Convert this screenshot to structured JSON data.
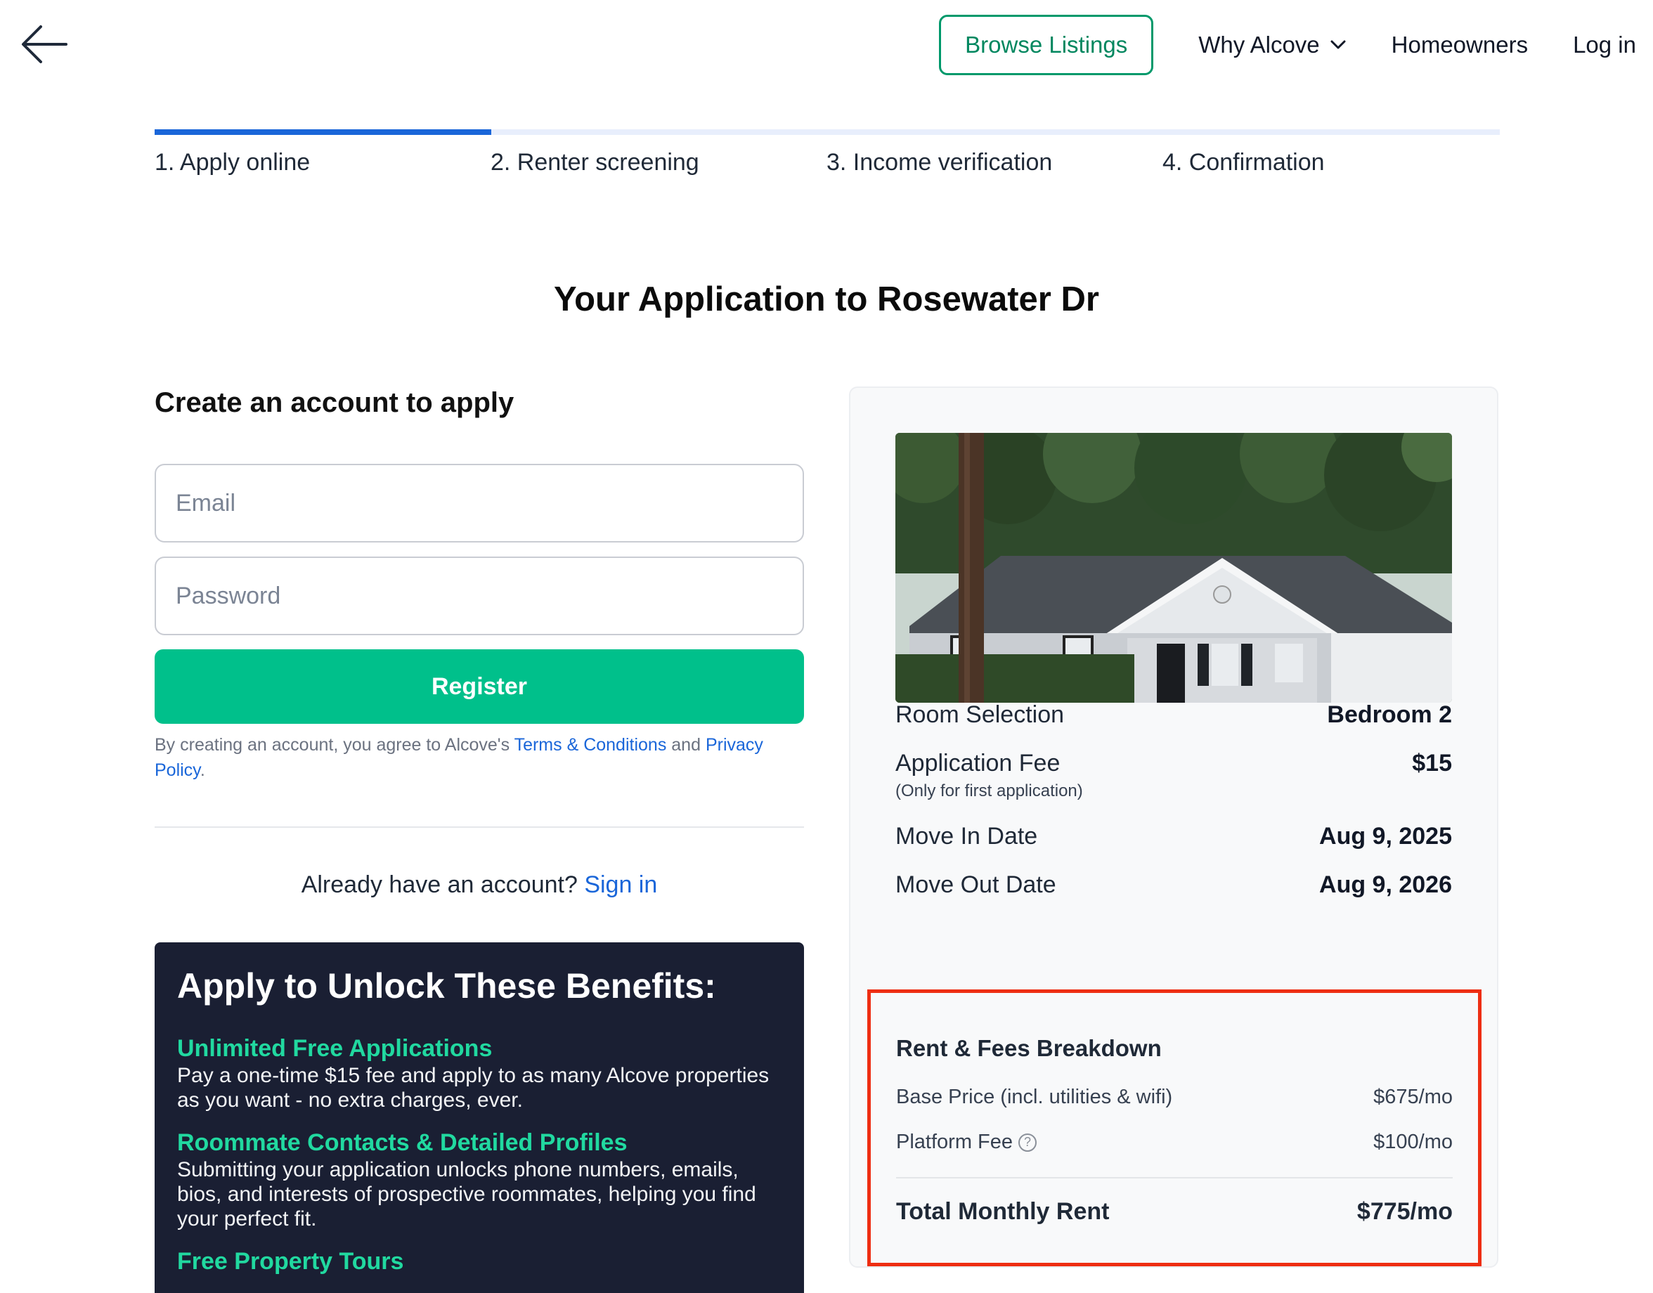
{
  "nav": {
    "browse_label": "Browse Listings",
    "why_label": "Why Alcove",
    "homeowners_label": "Homeowners",
    "login_label": "Log in"
  },
  "steps": [
    {
      "label": "1. Apply online",
      "active": true
    },
    {
      "label": "2. Renter screening",
      "active": false
    },
    {
      "label": "3. Income verification",
      "active": false
    },
    {
      "label": "4. Confirmation",
      "active": false
    }
  ],
  "progress_fraction": 0.25,
  "page_title": "Your Application to Rosewater Dr",
  "account": {
    "heading": "Create an account to apply",
    "email_placeholder": "Email",
    "password_placeholder": "Password",
    "register_label": "Register",
    "terms_prefix": "By creating an account, you agree to Alcove's ",
    "terms_link": "Terms & Conditions",
    "terms_and": " and ",
    "privacy_link": "Privacy Policy",
    "terms_suffix": ".",
    "already_text": "Already have an account? ",
    "signin_link": "Sign in"
  },
  "benefits": {
    "heading": "Apply to Unlock These Benefits:",
    "items": [
      {
        "title": "Unlimited Free Applications",
        "desc": "Pay a one-time $15 fee and apply to as many Alcove properties as you want - no extra charges, ever."
      },
      {
        "title": "Roommate Contacts & Detailed Profiles",
        "desc": "Submitting your application unlocks phone numbers, emails, bios, and interests of prospective roommates, helping you find your perfect fit."
      },
      {
        "title": "Free Property Tours",
        "desc": ""
      }
    ]
  },
  "summary": {
    "room_label": "Room Selection",
    "room_value": "Bedroom 2",
    "fee_label": "Application Fee",
    "fee_note": "(Only for first application)",
    "fee_value": "$15",
    "movein_label": "Move In Date",
    "movein_value": "Aug 9, 2025",
    "moveout_label": "Move Out Date",
    "moveout_value": "Aug 9, 2026"
  },
  "breakdown": {
    "heading": "Rent & Fees Breakdown",
    "base_label": "Base Price (incl. utilities & wifi)",
    "base_value": "$675/mo",
    "platform_label": "Platform Fee",
    "platform_value": "$100/mo",
    "total_label": "Total Monthly Rent",
    "total_value": "$775/mo"
  },
  "colors": {
    "accent_green": "#00c08b",
    "link_blue": "#1a66d9",
    "highlight_red": "#ee2e12",
    "benefits_bg": "#1a1f33",
    "benefit_title": "#21d9a0"
  },
  "icons": {
    "back": "arrow-left-icon",
    "dropdown": "chevron-down-icon",
    "help": "question-circle-icon"
  }
}
